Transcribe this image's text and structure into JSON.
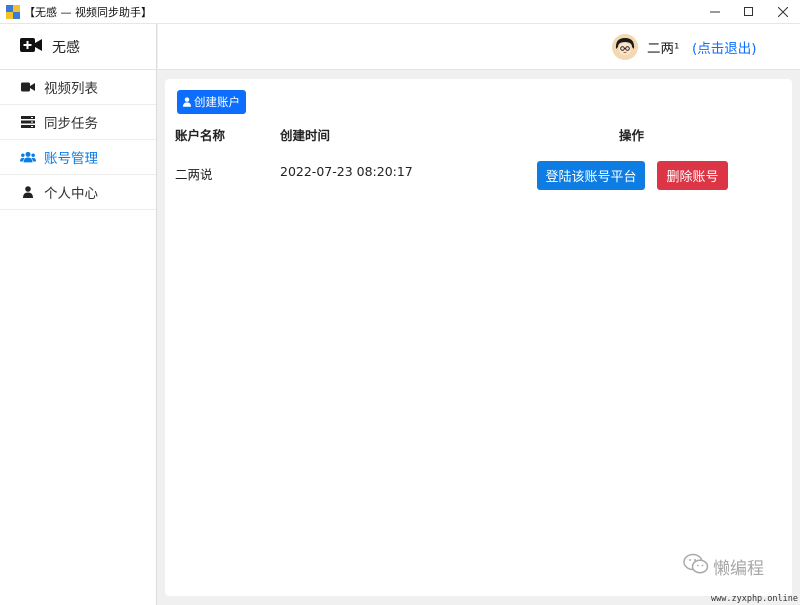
{
  "window": {
    "title": "【无感 — 视频同步助手】",
    "controls": [
      "minimize-icon",
      "maximize-icon",
      "close-icon"
    ]
  },
  "brand": {
    "icon": "video-plus-icon",
    "name": "无感"
  },
  "sidebar": {
    "items": [
      {
        "icon": "video-camera-icon",
        "label": "视频列表",
        "active": false
      },
      {
        "icon": "server-icon",
        "label": "同步任务",
        "active": false
      },
      {
        "icon": "users-icon",
        "label": "账号管理",
        "active": true
      },
      {
        "icon": "user-icon",
        "label": "个人中心",
        "active": false
      }
    ]
  },
  "header": {
    "user_name": "二两¹",
    "logout_label": "(点击退出)"
  },
  "content": {
    "create_button": {
      "icon": "user-icon",
      "label": "创建账户"
    },
    "table": {
      "columns": [
        "账户名称",
        "创建时间",
        "操作"
      ],
      "rows": [
        {
          "name": "二两说",
          "created": "2022-07-23 08:20:17",
          "login_label": "登陆该账号平台",
          "delete_label": "删除账号"
        }
      ]
    }
  },
  "watermark": {
    "text": "懒编程",
    "site": "www.zyxphp.online"
  },
  "colors": {
    "primary": "#0d6efd",
    "login_button": "#0d7de3",
    "danger": "#dc3545",
    "active_nav": "#0d7de3"
  }
}
